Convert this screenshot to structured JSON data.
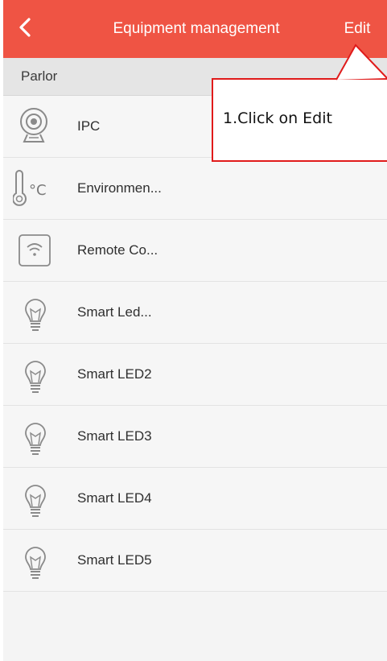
{
  "header": {
    "back_icon": "chevron-left-icon",
    "title": "Equipment management",
    "edit_label": "Edit",
    "background_color": "#ef5444"
  },
  "section": {
    "label": "Parlor"
  },
  "devices": [
    {
      "label": "IPC",
      "icon": "camera-icon"
    },
    {
      "label": "Environmen...",
      "icon": "thermometer-icon"
    },
    {
      "label": "Remote Co...",
      "icon": "wifi-remote-icon"
    },
    {
      "label": "Smart Led...",
      "icon": "bulb-icon"
    },
    {
      "label": "Smart LED2",
      "icon": "bulb-icon"
    },
    {
      "label": "Smart LED3",
      "icon": "bulb-icon"
    },
    {
      "label": "Smart LED4",
      "icon": "bulb-icon"
    },
    {
      "label": "Smart LED5",
      "icon": "bulb-icon"
    }
  ],
  "annotation": {
    "text": "1.Click on Edit",
    "border_color": "#e01b1b"
  }
}
